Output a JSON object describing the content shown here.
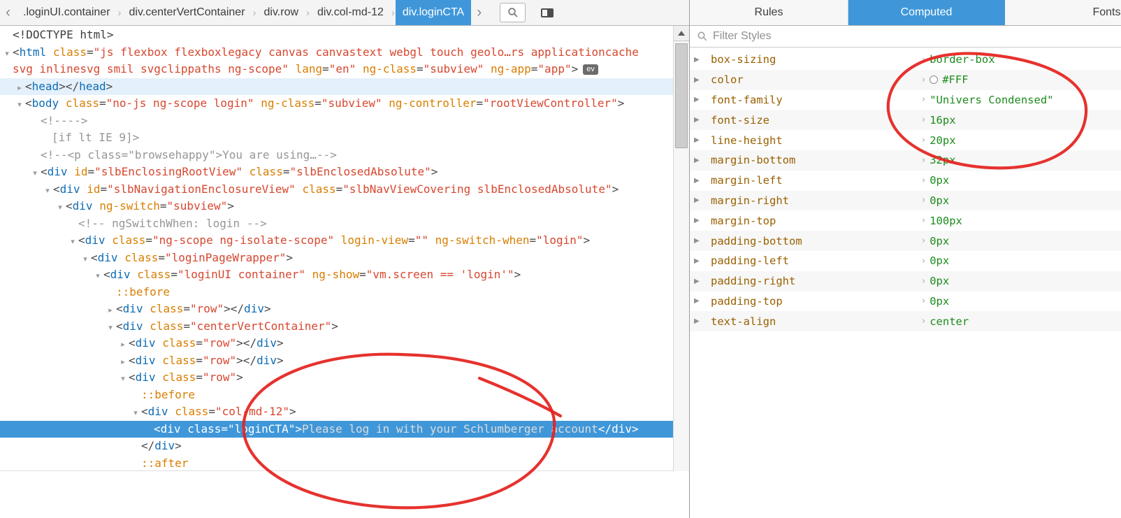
{
  "colors": {
    "accent": "#3f97d9",
    "tag": "#0d6cb5",
    "attr": "#d97e00",
    "value": "#d7472f",
    "comment": "#969696",
    "pseudo": "#d97e00",
    "propName": "#996000",
    "propValue": "#1d8c1d",
    "annotation": "#e4211c"
  },
  "toolbar": {
    "breadcrumbs": [
      {
        "label": ".loginUI.container",
        "selected": false
      },
      {
        "label": "div.centerVertContainer",
        "selected": false
      },
      {
        "label": "div.row",
        "selected": false
      },
      {
        "label": "div.col-md-12",
        "selected": false
      },
      {
        "label": "div.loginCTA",
        "selected": true
      }
    ],
    "back_icon": "‹",
    "forward_icon": "›"
  },
  "right_panel": {
    "tabs": [
      {
        "label": "Rules",
        "active": false
      },
      {
        "label": "Computed",
        "active": true
      },
      {
        "label": "Fonts",
        "active": false
      }
    ],
    "filter_placeholder": "Filter Styles",
    "computed": [
      {
        "name": "box-sizing",
        "value": "border-box"
      },
      {
        "name": "color",
        "value": "#FFF",
        "swatch": "#FFFFFF"
      },
      {
        "name": "font-family",
        "value": "\"Univers Condensed\""
      },
      {
        "name": "font-size",
        "value": "16px"
      },
      {
        "name": "line-height",
        "value": "20px"
      },
      {
        "name": "margin-bottom",
        "value": "32px"
      },
      {
        "name": "margin-left",
        "value": "0px"
      },
      {
        "name": "margin-right",
        "value": "0px"
      },
      {
        "name": "margin-top",
        "value": "100px"
      },
      {
        "name": "padding-bottom",
        "value": "0px"
      },
      {
        "name": "padding-left",
        "value": "0px"
      },
      {
        "name": "padding-right",
        "value": "0px"
      },
      {
        "name": "padding-top",
        "value": "0px"
      },
      {
        "name": "text-align",
        "value": "center"
      }
    ]
  },
  "markup_tree": {
    "lines": [
      {
        "indent": 18,
        "tokens": [
          [
            "doctype",
            "<!DOCTYPE html>"
          ]
        ]
      },
      {
        "indent": 18,
        "twisty": "down",
        "tokens": [
          [
            "p",
            "<"
          ],
          [
            "tag",
            "html"
          ],
          [
            "sp",
            " "
          ],
          [
            "attr",
            "class"
          ],
          [
            "p",
            "="
          ],
          [
            "val",
            "\"js flexbox flexboxlegacy canvas canvastext webgl touch geolo…rs applicationcache"
          ]
        ]
      },
      {
        "indent": 18,
        "tokens": [
          [
            "val",
            "svg inlinesvg smil svgclippaths ng-scope\""
          ],
          [
            "sp",
            " "
          ],
          [
            "attr",
            "lang"
          ],
          [
            "p",
            "="
          ],
          [
            "val",
            "\"en\""
          ],
          [
            "sp",
            " "
          ],
          [
            "attr",
            "ng-class"
          ],
          [
            "p",
            "="
          ],
          [
            "val",
            "\"subview\""
          ],
          [
            "sp",
            " "
          ],
          [
            "attr",
            "ng-app"
          ],
          [
            "p",
            "="
          ],
          [
            "val",
            "\"app\""
          ],
          [
            "p",
            ">"
          ],
          [
            "badge",
            "ev"
          ]
        ]
      },
      {
        "indent": 36,
        "twisty": "right",
        "state": "hover",
        "tokens": [
          [
            "p",
            "<"
          ],
          [
            "tag",
            "head"
          ],
          [
            "p",
            "></"
          ],
          [
            "tag",
            "head"
          ],
          [
            "p",
            ">"
          ]
        ]
      },
      {
        "indent": 36,
        "twisty": "down",
        "tokens": [
          [
            "p",
            "<"
          ],
          [
            "tag",
            "body"
          ],
          [
            "sp",
            " "
          ],
          [
            "attr",
            "class"
          ],
          [
            "p",
            "="
          ],
          [
            "val",
            "\"no-js ng-scope login\""
          ],
          [
            "sp",
            " "
          ],
          [
            "attr",
            "ng-class"
          ],
          [
            "p",
            "="
          ],
          [
            "val",
            "\"subview\""
          ],
          [
            "sp",
            " "
          ],
          [
            "attr",
            "ng-controller"
          ],
          [
            "p",
            "="
          ],
          [
            "val",
            "\"rootViewController\""
          ],
          [
            "p",
            ">"
          ]
        ]
      },
      {
        "indent": 58,
        "tokens": [
          [
            "comment",
            "<!---->"
          ]
        ]
      },
      {
        "indent": 74,
        "tokens": [
          [
            "comment",
            "[if lt IE 9]>"
          ]
        ]
      },
      {
        "indent": 58,
        "tokens": [
          [
            "comment",
            "<!--<p class=\"browsehappy\">You are using…-->"
          ]
        ]
      },
      {
        "indent": 58,
        "twisty": "down",
        "tokens": [
          [
            "p",
            "<"
          ],
          [
            "tag",
            "div"
          ],
          [
            "sp",
            " "
          ],
          [
            "attr",
            "id"
          ],
          [
            "p",
            "="
          ],
          [
            "val",
            "\"slbEnclosingRootView\""
          ],
          [
            "sp",
            " "
          ],
          [
            "attr",
            "class"
          ],
          [
            "p",
            "="
          ],
          [
            "val",
            "\"slbEnclosedAbsolute\""
          ],
          [
            "p",
            ">"
          ]
        ]
      },
      {
        "indent": 76,
        "twisty": "down",
        "tokens": [
          [
            "p",
            "<"
          ],
          [
            "tag",
            "div"
          ],
          [
            "sp",
            " "
          ],
          [
            "attr",
            "id"
          ],
          [
            "p",
            "="
          ],
          [
            "val",
            "\"slbNavigationEnclosureView\""
          ],
          [
            "sp",
            " "
          ],
          [
            "attr",
            "class"
          ],
          [
            "p",
            "="
          ],
          [
            "val",
            "\"slbNavViewCovering slbEnclosedAbsolute\""
          ],
          [
            "p",
            ">"
          ]
        ]
      },
      {
        "indent": 94,
        "twisty": "down",
        "tokens": [
          [
            "p",
            "<"
          ],
          [
            "tag",
            "div"
          ],
          [
            "sp",
            " "
          ],
          [
            "attr",
            "ng-switch"
          ],
          [
            "p",
            "="
          ],
          [
            "val",
            "\"subview\""
          ],
          [
            "p",
            ">"
          ]
        ]
      },
      {
        "indent": 112,
        "tokens": [
          [
            "comment",
            "<!-- ngSwitchWhen: login -->"
          ]
        ]
      },
      {
        "indent": 112,
        "twisty": "down",
        "tokens": [
          [
            "p",
            "<"
          ],
          [
            "tag",
            "div"
          ],
          [
            "sp",
            " "
          ],
          [
            "attr",
            "class"
          ],
          [
            "p",
            "="
          ],
          [
            "val",
            "\"ng-scope ng-isolate-scope\""
          ],
          [
            "sp",
            " "
          ],
          [
            "attr",
            "login-view"
          ],
          [
            "p",
            "="
          ],
          [
            "val",
            "\"\""
          ],
          [
            "sp",
            " "
          ],
          [
            "attr",
            "ng-switch-when"
          ],
          [
            "p",
            "="
          ],
          [
            "val",
            "\"login\""
          ],
          [
            "p",
            ">"
          ]
        ]
      },
      {
        "indent": 130,
        "twisty": "down",
        "tokens": [
          [
            "p",
            "<"
          ],
          [
            "tag",
            "div"
          ],
          [
            "sp",
            " "
          ],
          [
            "attr",
            "class"
          ],
          [
            "p",
            "="
          ],
          [
            "val",
            "\"loginPageWrapper\""
          ],
          [
            "p",
            ">"
          ]
        ]
      },
      {
        "indent": 148,
        "twisty": "down",
        "tokens": [
          [
            "p",
            "<"
          ],
          [
            "tag",
            "div"
          ],
          [
            "sp",
            " "
          ],
          [
            "attr",
            "class"
          ],
          [
            "p",
            "="
          ],
          [
            "val",
            "\"loginUI container\""
          ],
          [
            "sp",
            " "
          ],
          [
            "attr",
            "ng-show"
          ],
          [
            "p",
            "="
          ],
          [
            "val",
            "\"vm.screen == 'login'\""
          ],
          [
            "p",
            ">"
          ]
        ]
      },
      {
        "indent": 166,
        "tokens": [
          [
            "pseudo",
            "::before"
          ]
        ]
      },
      {
        "indent": 166,
        "twisty": "right",
        "tokens": [
          [
            "p",
            "<"
          ],
          [
            "tag",
            "div"
          ],
          [
            "sp",
            " "
          ],
          [
            "attr",
            "class"
          ],
          [
            "p",
            "="
          ],
          [
            "val",
            "\"row\""
          ],
          [
            "p",
            "></"
          ],
          [
            "tag",
            "div"
          ],
          [
            "p",
            ">"
          ]
        ]
      },
      {
        "indent": 166,
        "twisty": "down",
        "tokens": [
          [
            "p",
            "<"
          ],
          [
            "tag",
            "div"
          ],
          [
            "sp",
            " "
          ],
          [
            "attr",
            "class"
          ],
          [
            "p",
            "="
          ],
          [
            "val",
            "\"centerVertContainer\""
          ],
          [
            "p",
            ">"
          ]
        ]
      },
      {
        "indent": 184,
        "twisty": "right",
        "tokens": [
          [
            "p",
            "<"
          ],
          [
            "tag",
            "div"
          ],
          [
            "sp",
            " "
          ],
          [
            "attr",
            "class"
          ],
          [
            "p",
            "="
          ],
          [
            "val",
            "\"row\""
          ],
          [
            "p",
            "></"
          ],
          [
            "tag",
            "div"
          ],
          [
            "p",
            ">"
          ]
        ]
      },
      {
        "indent": 184,
        "twisty": "right",
        "tokens": [
          [
            "p",
            "<"
          ],
          [
            "tag",
            "div"
          ],
          [
            "sp",
            " "
          ],
          [
            "attr",
            "class"
          ],
          [
            "p",
            "="
          ],
          [
            "val",
            "\"row\""
          ],
          [
            "p",
            "></"
          ],
          [
            "tag",
            "div"
          ],
          [
            "p",
            ">"
          ]
        ]
      },
      {
        "indent": 184,
        "twisty": "down",
        "tokens": [
          [
            "p",
            "<"
          ],
          [
            "tag",
            "div"
          ],
          [
            "sp",
            " "
          ],
          [
            "attr",
            "class"
          ],
          [
            "p",
            "="
          ],
          [
            "val",
            "\"row\""
          ],
          [
            "p",
            ">"
          ]
        ]
      },
      {
        "indent": 202,
        "tokens": [
          [
            "pseudo",
            "::before"
          ]
        ]
      },
      {
        "indent": 202,
        "twisty": "down",
        "tokens": [
          [
            "p",
            "<"
          ],
          [
            "tag",
            "div"
          ],
          [
            "sp",
            " "
          ],
          [
            "attr",
            "class"
          ],
          [
            "p",
            "="
          ],
          [
            "val",
            "\"col-md-12\""
          ],
          [
            "p",
            ">"
          ]
        ]
      },
      {
        "indent": 220,
        "state": "selected",
        "tokens": [
          [
            "p",
            "<"
          ],
          [
            "tag",
            "div"
          ],
          [
            "sp",
            " "
          ],
          [
            "attr",
            "class"
          ],
          [
            "p",
            "="
          ],
          [
            "val",
            "\"loginCTA\""
          ],
          [
            "p",
            ">"
          ],
          [
            "text",
            "Please log in with your Schlumberger account"
          ],
          [
            "p",
            "</"
          ],
          [
            "tag",
            "div"
          ],
          [
            "p",
            ">"
          ]
        ]
      },
      {
        "indent": 202,
        "tokens": [
          [
            "p",
            "</"
          ],
          [
            "tag",
            "div"
          ],
          [
            "p",
            ">"
          ]
        ]
      },
      {
        "indent": 202,
        "tokens": [
          [
            "pseudo",
            "::after"
          ]
        ]
      }
    ]
  }
}
